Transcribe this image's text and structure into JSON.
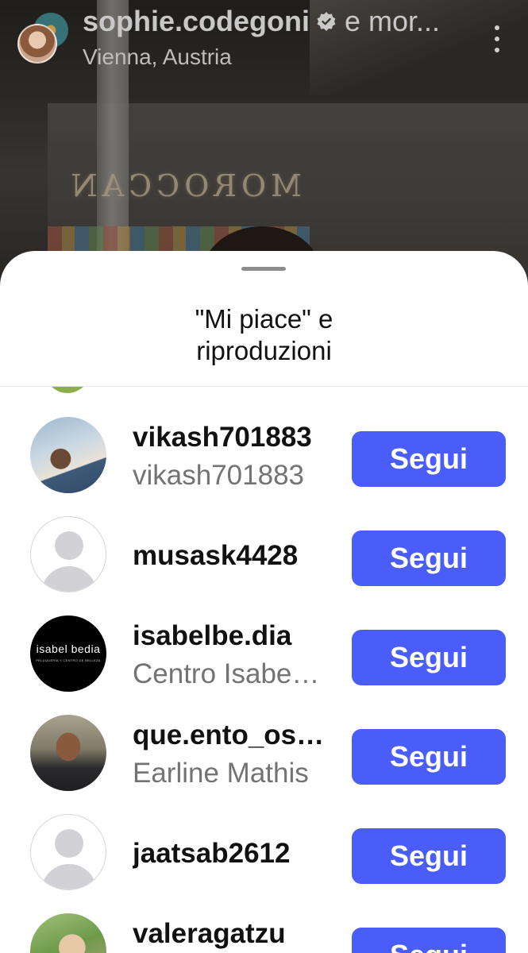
{
  "header": {
    "username": "sophie.codegoni",
    "more_text": "e mor...",
    "location": "Vienna, Austria"
  },
  "background": {
    "sign_text": "MOROCCAN"
  },
  "sheet": {
    "title_line1": "\"Mi piace\" e",
    "title_line2": "riproduzioni"
  },
  "list": [
    {
      "username": "vikash701883",
      "fullname": "vikash701883",
      "button": "Segui"
    },
    {
      "username": "musask4428",
      "fullname": "",
      "button": "Segui"
    },
    {
      "username": "isabelbe.dia",
      "fullname": "Centro Isabe…",
      "button": "Segui",
      "logo_main": "isabel bedia",
      "logo_sub": "PELUQUERÍA Y CENTRO DE BELLEZA"
    },
    {
      "username": "que.ento_os…",
      "fullname": "Earline Mathis",
      "button": "Segui"
    },
    {
      "username": "jaatsab2612",
      "fullname": "",
      "button": "Segui"
    },
    {
      "username": "valeragatzu",
      "fullname": "",
      "button": "Segui"
    }
  ],
  "colors": {
    "follow_button": "#4a5df9",
    "secondary_text": "#737373"
  },
  "icons": [
    "verified-badge-icon",
    "more-options-icon",
    "default-avatar-icon"
  ]
}
